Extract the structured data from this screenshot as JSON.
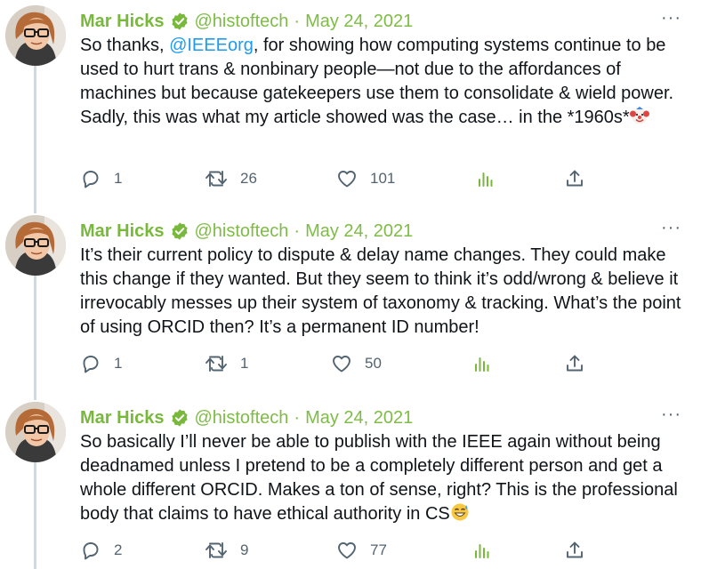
{
  "tweets": [
    {
      "author_name": "Mar Hicks",
      "handle": "@histoftech",
      "separator": "·",
      "date": "May 24, 2021",
      "more": "···",
      "text_before": "So thanks, ",
      "mention": "@IEEEorg",
      "text_after": ", for showing how computing systems continue to be used to hurt trans & nonbinary people—not due to the affordances of machines but because gatekeepers use them to consolidate & wield power. Sadly, this was what my article showed was the case… in the *1960s*",
      "emoji": "clown-face",
      "replies": "1",
      "retweets": "26",
      "likes": "101"
    },
    {
      "author_name": "Mar Hicks",
      "handle": "@histoftech",
      "separator": "·",
      "date": "May 24, 2021",
      "more": "···",
      "text": "It’s their current policy to dispute & delay name changes. They could make this change if they wanted. But they seem to think it’s odd/wrong & believe it irrevocably messes up their system of taxonomy & tracking. What’s the point of using ORCID then? It’s a permanent ID number!",
      "replies": "1",
      "retweets": "1",
      "likes": "50"
    },
    {
      "author_name": "Mar Hicks",
      "handle": "@histoftech",
      "separator": "·",
      "date": "May 24, 2021",
      "more": "···",
      "text": "So basically I’ll never be able to publish with the IEEE again without being deadnamed unless I pretend to be a completely different person and get a whole different ORCID. Makes a ton of sense, right? This is the professional body that claims to have ethical authority in CS",
      "emoji": "grinning-face-with-sweat",
      "replies": "2",
      "retweets": "9",
      "likes": "77"
    }
  ],
  "colors": {
    "name": "#78b93c",
    "handle": "#7ebc46",
    "mention": "#1d9bf0",
    "text": "#0f1419",
    "muted": "#536471",
    "analytics": "#78b93c",
    "thread_line": "#cfd9de"
  },
  "icons": [
    "verified-badge-icon",
    "reply-icon",
    "retweet-icon",
    "like-icon",
    "analytics-icon",
    "share-icon",
    "more-icon"
  ]
}
